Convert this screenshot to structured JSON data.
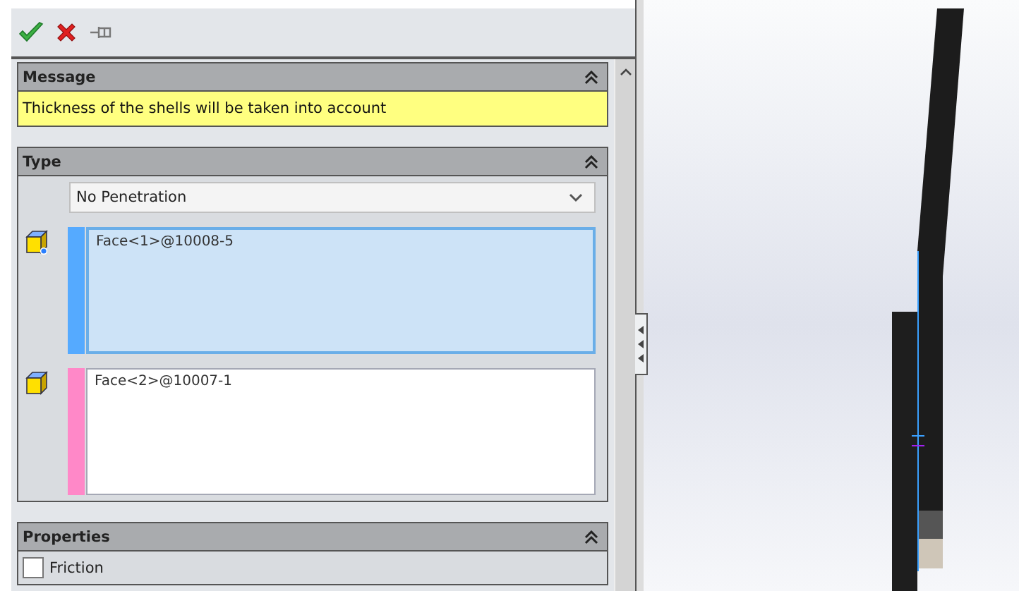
{
  "toolbar": {
    "buttons": [
      {
        "kind": "ok"
      },
      {
        "kind": "cancel"
      },
      {
        "kind": "pin"
      }
    ]
  },
  "message": {
    "title": "Message",
    "expanded": true,
    "text": "Thickness of the shells will be taken into account"
  },
  "type": {
    "title": "Type",
    "expanded": true,
    "dropdown": {
      "value": "No Penetration"
    },
    "selections": [
      {
        "text": "Face<1>@10008-5",
        "color": "#55aaff",
        "selected": true
      },
      {
        "text": "Face<2>@10007-1",
        "color": "#ff88c8",
        "selected": false
      }
    ]
  },
  "properties": {
    "title": "Properties",
    "expanded": true,
    "options": [
      {
        "label": "Friction",
        "checked": false
      }
    ]
  }
}
